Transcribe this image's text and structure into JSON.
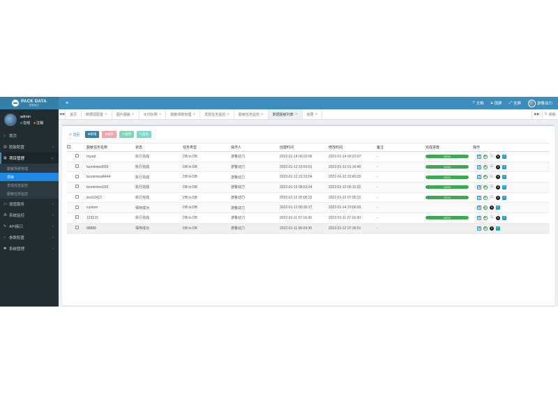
{
  "brand": {
    "title": "PACK DATA",
    "subtitle": "游鲁动力"
  },
  "user": {
    "name": "admin",
    "online": "在线",
    "logout": "注销"
  },
  "sidebar": {
    "items": [
      {
        "label": "首页",
        "icon": "home-icon"
      },
      {
        "label": "脱敏配置",
        "icon": "list-icon"
      },
      {
        "label": "项目管理",
        "icon": "table-icon"
      },
      {
        "label": "增值服务",
        "icon": "monitor-icon"
      },
      {
        "label": "系统监控",
        "icon": "cluster-icon"
      },
      {
        "label": "API接口",
        "icon": "wrench-icon"
      },
      {
        "label": "参数配置",
        "icon": "circle-icon"
      },
      {
        "label": "系统管理",
        "icon": "gear-icon"
      }
    ],
    "submenu": [
      "脱敏场景管理",
      "项目",
      "发现任务监控",
      "脱敏任务监控"
    ]
  },
  "header": {
    "menu_icon": "hamburger-icon",
    "doc": "文档",
    "lock": "锁屏",
    "fullscreen": "全屏",
    "user": "游鲁动力"
  },
  "tabs": [
    "首页",
    "数据源配置",
    "图片脱敏",
    "水印标明",
    "脱敏场景管理",
    "发现任务监控",
    "脱敏任务监控",
    "数据脱敏列表",
    "结果"
  ],
  "active_tab": "数据脱敏列表",
  "refresh": "刷新",
  "toolbar": {
    "back": "返回",
    "add": "新增",
    "delete": "删除",
    "edit": "修改",
    "run": "启动"
  },
  "table": {
    "columns": [
      "脱敏任务名称",
      "状态",
      "任务类型",
      "操作人",
      "创建时间",
      "修改时间",
      "备注",
      "完成进度",
      "操作"
    ],
    "rows": [
      {
        "name": "mysql",
        "status": "执行完成",
        "type": "DB to DB",
        "operator": "游鲁动力",
        "created": "2022-01-14 00:22:06",
        "modified": "2022-01-14 00:22:07",
        "note": "-",
        "progress_label": "100%",
        "progress": 1.0,
        "actions": [
          "copy",
          "play",
          "log",
          "stop",
          "filter"
        ]
      },
      {
        "name": "tuomintest555",
        "status": "执行完成",
        "type": "DB to DB",
        "operator": "游鲁动力",
        "created": "2022-01-12 23:53:01",
        "modified": "2022-01-13 01:16:40",
        "note": "-",
        "progress_label": "100%",
        "progress": 1.0,
        "actions": [
          "copy",
          "play",
          "log",
          "stop",
          "filter"
        ]
      },
      {
        "name": "tuomintest4444",
        "status": "执行完成",
        "type": "DB to DB",
        "operator": "游鲁动力",
        "created": "2022-01-12 23:32:04",
        "modified": "2022-01-12 23:40:20",
        "note": "-",
        "progress_label": "100%",
        "progress": 1.0,
        "actions": [
          "copy",
          "play",
          "log",
          "stop",
          "filter"
        ]
      },
      {
        "name": "tuomintest333",
        "status": "执行完成",
        "type": "DB to DB",
        "operator": "游鲁动力",
        "created": "2022-01-12 08:53:24",
        "modified": "2022-01-12 05:12:01",
        "note": "-",
        "progress_label": "100%",
        "progress": 1.0,
        "actions": [
          "copy",
          "play",
          "log",
          "stop",
          "filter"
        ]
      },
      {
        "name": "test12412",
        "status": "执行完成",
        "type": "DB to DB",
        "operator": "游鲁动力",
        "created": "2022-01-12 07:05:22",
        "modified": "2022-01-12 07:05:22",
        "note": "-",
        "progress_label": "100%",
        "progress": 1.0,
        "actions": [
          "copy",
          "play",
          "log",
          "stop",
          "filter"
        ]
      },
      {
        "name": "custom",
        "status": "保存成功",
        "type": "DB to DB",
        "operator": "游鲁动力",
        "created": "2022-01-12 00:36:17",
        "modified": "2022-01-14 23:06:03",
        "note": "-",
        "progress_label": "",
        "progress": 0,
        "actions": [
          "copy",
          "play",
          "stop",
          "filter"
        ]
      },
      {
        "name": "123123",
        "status": "执行完成",
        "type": "DB to DB",
        "operator": "游鲁动力",
        "created": "2022-01-11 07:16:30",
        "modified": "2022-01-11 07:16:30",
        "note": "-",
        "progress_label": "100%",
        "progress": 1.0,
        "actions": [
          "copy",
          "play",
          "log",
          "stop",
          "filter"
        ]
      },
      {
        "name": "88888",
        "status": "保存成功",
        "type": "DB to DB",
        "operator": "游鲁动力",
        "created": "2022-01-11 06:09:30",
        "modified": "2022-01-12 07:36:51",
        "note": "-",
        "progress_label": "",
        "progress": 0,
        "actions": [
          "copy",
          "play",
          "stop",
          "filter"
        ]
      }
    ]
  },
  "colors": {
    "header": "#3c8dbc",
    "sidebar": "#222d32",
    "active_sub": "#1e88e5",
    "progress": "#3aa94f"
  }
}
